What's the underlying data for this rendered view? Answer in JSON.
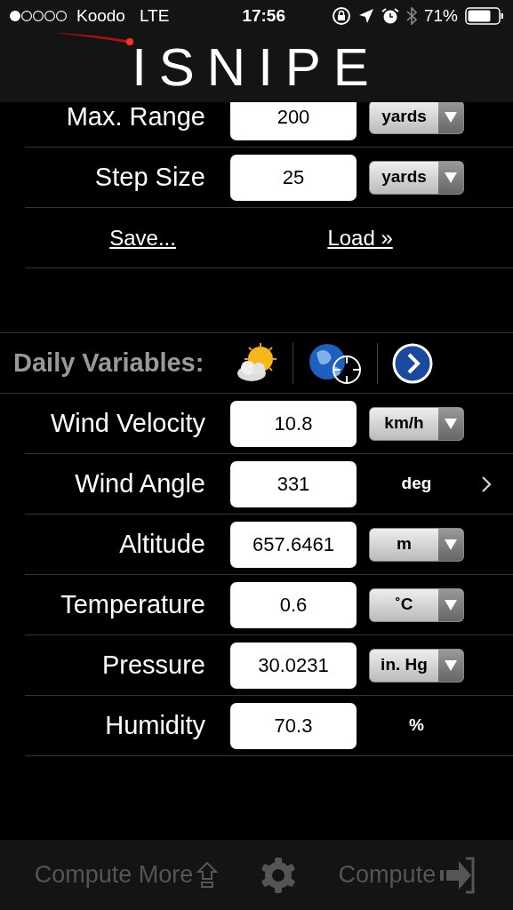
{
  "status_bar": {
    "carrier": "Koodo",
    "network": "LTE",
    "time": "17:56",
    "battery": "71%"
  },
  "header": {
    "logo": "ISNIPE"
  },
  "range_rows": [
    {
      "label": "Max. Range",
      "value": "200",
      "unit": "yards",
      "kind": "dropdown"
    },
    {
      "label": "Step Size",
      "value": "25",
      "unit": "yards",
      "kind": "dropdown"
    }
  ],
  "links": [
    "Save...",
    "Load »"
  ],
  "daily_variables": {
    "title": "Daily Variables:"
  },
  "variable_rows": [
    {
      "label": "Wind Velocity",
      "value": "10.8",
      "unit": "km/h",
      "kind": "dropdown",
      "disclosure": false
    },
    {
      "label": "Wind Angle",
      "value": "331",
      "unit": "deg",
      "kind": "plain",
      "disclosure": true
    },
    {
      "label": "Altitude",
      "value": "657.6461",
      "unit": "m",
      "kind": "dropdown",
      "disclosure": false
    },
    {
      "label": "Temperature",
      "value": "0.6",
      "unit": "˚C",
      "kind": "dropdown",
      "disclosure": false
    },
    {
      "label": "Pressure",
      "value": "30.0231",
      "unit": "in. Hg",
      "kind": "dropdown",
      "disclosure": false
    },
    {
      "label": "Humidity",
      "value": "70.3",
      "unit": "%",
      "kind": "plain",
      "disclosure": false
    }
  ],
  "toolbar": {
    "compute_more": "Compute More",
    "compute": "Compute"
  }
}
